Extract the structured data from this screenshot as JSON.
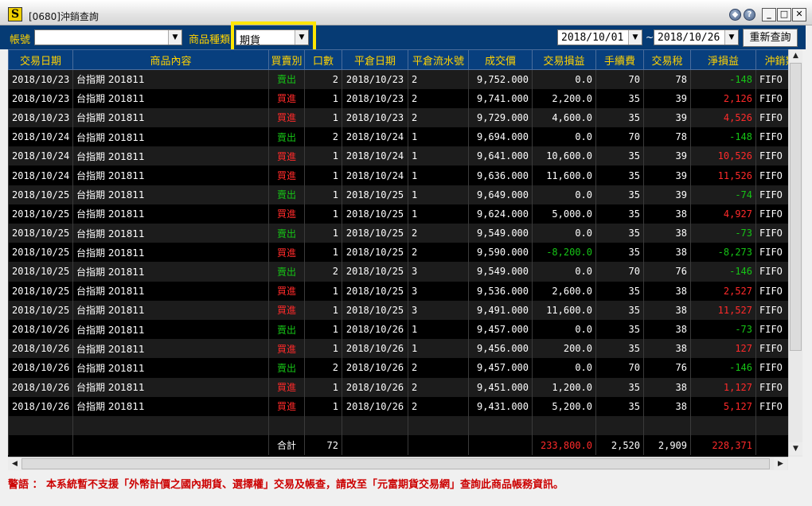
{
  "window": {
    "title": "[0680]沖銷查詢",
    "app_icon": "S",
    "buttons": {
      "info": "?",
      "minimize": "_",
      "maximize": "□",
      "close": "✕"
    }
  },
  "filters": {
    "account_label": "帳號",
    "account_value": "",
    "product_type_label": "商品種類",
    "product_type_value": "期貨",
    "date_from": "2018/10/01",
    "date_to": "2018/10/26",
    "date_separator": "~",
    "query_button": "重新查詢"
  },
  "table": {
    "columns": [
      "交易日期",
      "商品內容",
      "買賣別",
      "口數",
      "平倉日期",
      "平倉流水號",
      "成交價",
      "交易損益",
      "手續費",
      "交易稅",
      "淨損益",
      "沖銷類"
    ],
    "rows": [
      {
        "date": "2018/10/23",
        "product": "台指期  201811",
        "side": "賣出",
        "qty": "2",
        "close_date": "2018/10/23",
        "serial": "2",
        "price": "9,752.000",
        "pl": "0.0",
        "fee": "70",
        "tax": "78",
        "net": "-148",
        "type": "FIFO"
      },
      {
        "date": "2018/10/23",
        "product": "台指期  201811",
        "side": "買進",
        "qty": "1",
        "close_date": "2018/10/23",
        "serial": "2",
        "price": "9,741.000",
        "pl": "2,200.0",
        "fee": "35",
        "tax": "39",
        "net": "2,126",
        "type": "FIFO"
      },
      {
        "date": "2018/10/23",
        "product": "台指期  201811",
        "side": "買進",
        "qty": "1",
        "close_date": "2018/10/23",
        "serial": "2",
        "price": "9,729.000",
        "pl": "4,600.0",
        "fee": "35",
        "tax": "39",
        "net": "4,526",
        "type": "FIFO"
      },
      {
        "date": "2018/10/24",
        "product": "台指期  201811",
        "side": "賣出",
        "qty": "2",
        "close_date": "2018/10/24",
        "serial": "1",
        "price": "9,694.000",
        "pl": "0.0",
        "fee": "70",
        "tax": "78",
        "net": "-148",
        "type": "FIFO"
      },
      {
        "date": "2018/10/24",
        "product": "台指期  201811",
        "side": "買進",
        "qty": "1",
        "close_date": "2018/10/24",
        "serial": "1",
        "price": "9,641.000",
        "pl": "10,600.0",
        "fee": "35",
        "tax": "39",
        "net": "10,526",
        "type": "FIFO"
      },
      {
        "date": "2018/10/24",
        "product": "台指期  201811",
        "side": "買進",
        "qty": "1",
        "close_date": "2018/10/24",
        "serial": "1",
        "price": "9,636.000",
        "pl": "11,600.0",
        "fee": "35",
        "tax": "39",
        "net": "11,526",
        "type": "FIFO"
      },
      {
        "date": "2018/10/25",
        "product": "台指期  201811",
        "side": "賣出",
        "qty": "1",
        "close_date": "2018/10/25",
        "serial": "1",
        "price": "9,649.000",
        "pl": "0.0",
        "fee": "35",
        "tax": "39",
        "net": "-74",
        "type": "FIFO"
      },
      {
        "date": "2018/10/25",
        "product": "台指期  201811",
        "side": "買進",
        "qty": "1",
        "close_date": "2018/10/25",
        "serial": "1",
        "price": "9,624.000",
        "pl": "5,000.0",
        "fee": "35",
        "tax": "38",
        "net": "4,927",
        "type": "FIFO"
      },
      {
        "date": "2018/10/25",
        "product": "台指期  201811",
        "side": "賣出",
        "qty": "1",
        "close_date": "2018/10/25",
        "serial": "2",
        "price": "9,549.000",
        "pl": "0.0",
        "fee": "35",
        "tax": "38",
        "net": "-73",
        "type": "FIFO"
      },
      {
        "date": "2018/10/25",
        "product": "台指期  201811",
        "side": "買進",
        "qty": "1",
        "close_date": "2018/10/25",
        "serial": "2",
        "price": "9,590.000",
        "pl": "-8,200.0",
        "fee": "35",
        "tax": "38",
        "net": "-8,273",
        "type": "FIFO"
      },
      {
        "date": "2018/10/25",
        "product": "台指期  201811",
        "side": "賣出",
        "qty": "2",
        "close_date": "2018/10/25",
        "serial": "3",
        "price": "9,549.000",
        "pl": "0.0",
        "fee": "70",
        "tax": "76",
        "net": "-146",
        "type": "FIFO"
      },
      {
        "date": "2018/10/25",
        "product": "台指期  201811",
        "side": "買進",
        "qty": "1",
        "close_date": "2018/10/25",
        "serial": "3",
        "price": "9,536.000",
        "pl": "2,600.0",
        "fee": "35",
        "tax": "38",
        "net": "2,527",
        "type": "FIFO"
      },
      {
        "date": "2018/10/25",
        "product": "台指期  201811",
        "side": "買進",
        "qty": "1",
        "close_date": "2018/10/25",
        "serial": "3",
        "price": "9,491.000",
        "pl": "11,600.0",
        "fee": "35",
        "tax": "38",
        "net": "11,527",
        "type": "FIFO"
      },
      {
        "date": "2018/10/26",
        "product": "台指期  201811",
        "side": "賣出",
        "qty": "1",
        "close_date": "2018/10/26",
        "serial": "1",
        "price": "9,457.000",
        "pl": "0.0",
        "fee": "35",
        "tax": "38",
        "net": "-73",
        "type": "FIFO"
      },
      {
        "date": "2018/10/26",
        "product": "台指期  201811",
        "side": "買進",
        "qty": "1",
        "close_date": "2018/10/26",
        "serial": "1",
        "price": "9,456.000",
        "pl": "200.0",
        "fee": "35",
        "tax": "38",
        "net": "127",
        "type": "FIFO"
      },
      {
        "date": "2018/10/26",
        "product": "台指期  201811",
        "side": "賣出",
        "qty": "2",
        "close_date": "2018/10/26",
        "serial": "2",
        "price": "9,457.000",
        "pl": "0.0",
        "fee": "70",
        "tax": "76",
        "net": "-146",
        "type": "FIFO"
      },
      {
        "date": "2018/10/26",
        "product": "台指期  201811",
        "side": "買進",
        "qty": "1",
        "close_date": "2018/10/26",
        "serial": "2",
        "price": "9,451.000",
        "pl": "1,200.0",
        "fee": "35",
        "tax": "38",
        "net": "1,127",
        "type": "FIFO"
      },
      {
        "date": "2018/10/26",
        "product": "台指期  201811",
        "side": "買進",
        "qty": "1",
        "close_date": "2018/10/26",
        "serial": "2",
        "price": "9,431.000",
        "pl": "5,200.0",
        "fee": "35",
        "tax": "38",
        "net": "5,127",
        "type": "FIFO"
      }
    ],
    "totals": {
      "label": "合計",
      "qty": "72",
      "pl": "233,800.0",
      "fee": "2,520",
      "tax": "2,909",
      "net": "228,371"
    }
  },
  "footer": {
    "warning": "警語 ： 本系統暫不支援「外幣計價之國內期貨、選擇權」交易及帳查，請改至「元富期貨交易網」查詢此商品帳務資訊。"
  },
  "colors": {
    "toolbar_bg": "#063b74",
    "header_text": "#ffd200",
    "buy": "#ff2a2a",
    "sell": "#16c416",
    "highlight": "#ffe500"
  }
}
